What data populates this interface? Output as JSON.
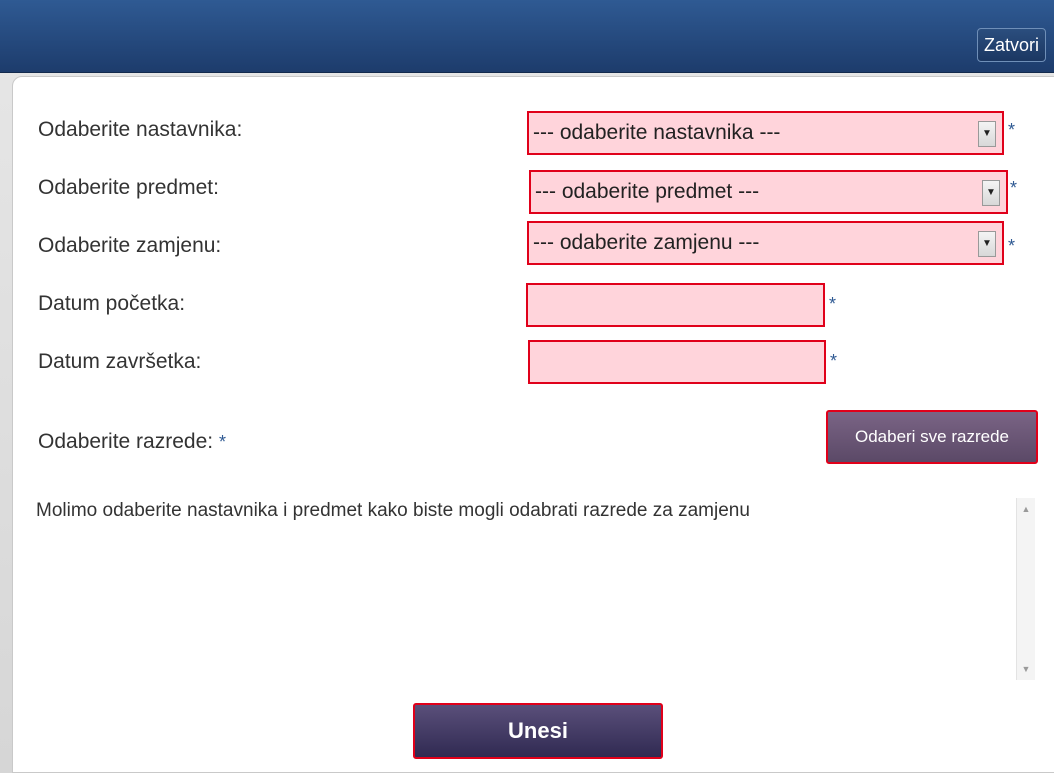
{
  "header": {
    "close_label": "Zatvori"
  },
  "form": {
    "teacher": {
      "label": "Odaberite nastavnika:",
      "value": "--- odaberite nastavnika ---"
    },
    "subject": {
      "label": "Odaberite predmet:",
      "value": "--- odaberite predmet ---"
    },
    "substitute": {
      "label": "Odaberite zamjenu:",
      "value": "--- odaberite zamjenu ---"
    },
    "start_date": {
      "label": "Datum početka:",
      "value": ""
    },
    "end_date": {
      "label": "Datum završetka:",
      "value": ""
    },
    "required_marker": "*",
    "classes": {
      "label": "Odaberite razrede:",
      "select_all_label": "Odaberi sve razrede",
      "message": "Molimo odaberite nastavnika i predmet kako biste mogli odabrati razrede za zamjenu"
    },
    "submit_label": "Unesi"
  },
  "colors": {
    "header_bg": "#1d3c6c",
    "invalid_field_bg": "#ffd4db",
    "invalid_border": "#e0001a",
    "required_star": "#2f5a93",
    "primary_button": "#302a52"
  },
  "icons": {
    "dropdown": "chevron-down-icon",
    "scroll_up": "arrow-up-icon",
    "scroll_down": "arrow-down-icon"
  }
}
